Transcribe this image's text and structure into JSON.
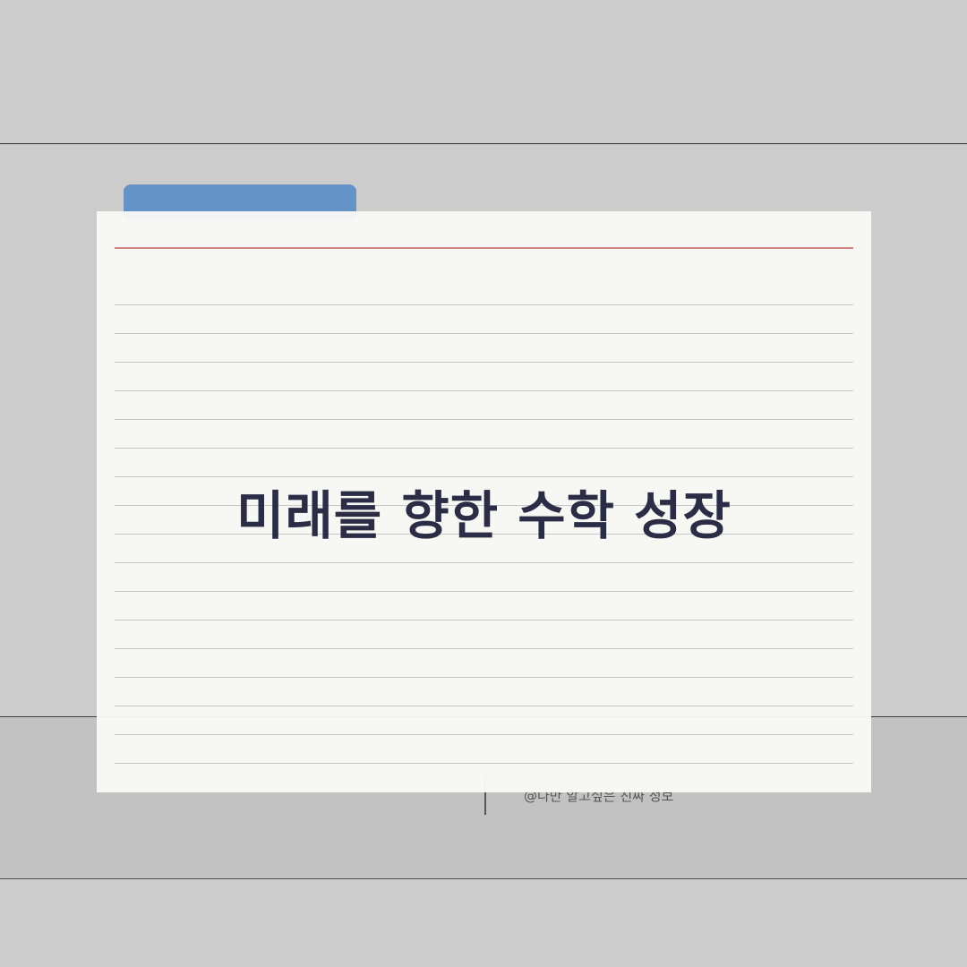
{
  "card": {
    "title": "미래를 향한 수학 성장"
  },
  "footer": {
    "credit": "@나만 알고싶은 진짜 정보"
  },
  "colors": {
    "background": "#cccccc",
    "tab": "#6593c8",
    "card": "#f9f9f6",
    "margin_line": "#d48686",
    "title_text": "#2a2d45"
  }
}
